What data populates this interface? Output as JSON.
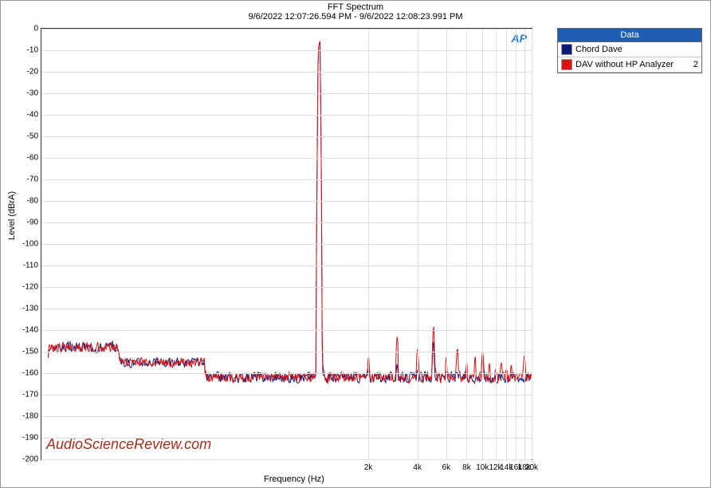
{
  "chart_data": {
    "type": "line",
    "title": "FFT Spectrum",
    "subtitle": "9/6/2022 12:07:26.594 PM - 9/6/2022 12:08:23.991 PM",
    "xlabel": "Frequency (Hz)",
    "ylabel": "Level (dBrA)",
    "xlim": [
      20,
      20000
    ],
    "ylim": [
      -200,
      0
    ],
    "x_ticks": [
      2000,
      4000,
      6000,
      8000,
      10000,
      12000,
      14000,
      16000,
      18000,
      20000
    ],
    "x_tick_labels": [
      "2k",
      "4k",
      "6k",
      "8k",
      "10k",
      "12k",
      "14k",
      "16k",
      "18k",
      "20k"
    ],
    "y_ticks": [
      0,
      -10,
      -20,
      -30,
      -40,
      -50,
      -60,
      -70,
      -80,
      -90,
      -100,
      -110,
      -120,
      -130,
      -140,
      -150,
      -160,
      -170,
      -180,
      -190,
      -200
    ],
    "legend_title": "Data",
    "logo": "AP",
    "watermark": "AudioScienceReview.com",
    "noise_floor": -162,
    "noise_amplitude": 3,
    "series": [
      {
        "name": "Chord Dave",
        "color": "#0b1a78",
        "swatch": "#0b1a78",
        "extra": "",
        "fundamental": {
          "freq": 1000,
          "level": -6
        },
        "harmonics": [
          {
            "freq": 2000,
            "level": -158
          },
          {
            "freq": 3000,
            "level": -155
          },
          {
            "freq": 4000,
            "level": -158
          },
          {
            "freq": 5000,
            "level": -145
          },
          {
            "freq": 6000,
            "level": -159
          },
          {
            "freq": 7000,
            "level": -160
          },
          {
            "freq": 10000,
            "level": -150
          },
          {
            "freq": 15000,
            "level": -160
          }
        ]
      },
      {
        "name": "DAV without HP Analyzer",
        "color": "#e01010",
        "swatch": "#e01010",
        "extra": "2",
        "fundamental": {
          "freq": 1000,
          "level": -6
        },
        "harmonics": [
          {
            "freq": 2000,
            "level": -152
          },
          {
            "freq": 3000,
            "level": -142
          },
          {
            "freq": 4000,
            "level": -148
          },
          {
            "freq": 5000,
            "level": -138
          },
          {
            "freq": 6000,
            "level": -152
          },
          {
            "freq": 7000,
            "level": -148
          },
          {
            "freq": 8000,
            "level": -155
          },
          {
            "freq": 9000,
            "level": -152
          },
          {
            "freq": 10000,
            "level": -149
          },
          {
            "freq": 11000,
            "level": -155
          },
          {
            "freq": 12000,
            "level": -158
          },
          {
            "freq": 13000,
            "level": -155
          },
          {
            "freq": 14000,
            "level": -158
          },
          {
            "freq": 15000,
            "level": -156
          },
          {
            "freq": 16000,
            "level": -160
          },
          {
            "freq": 17000,
            "level": -160
          },
          {
            "freq": 18000,
            "level": -151
          },
          {
            "freq": 19000,
            "level": -160
          }
        ]
      }
    ]
  }
}
